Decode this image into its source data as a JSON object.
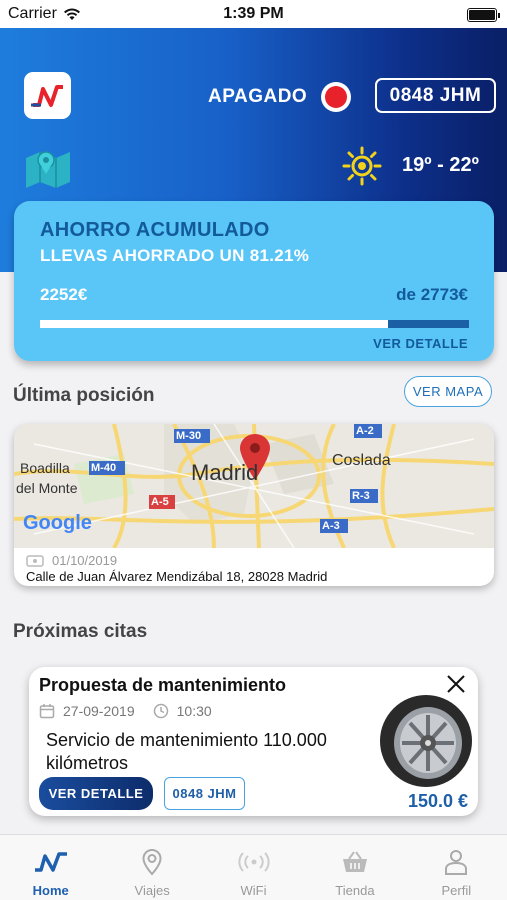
{
  "status_bar": {
    "carrier": "Carrier",
    "time": "1:39 PM"
  },
  "header": {
    "engine_status": "APAGADO",
    "plate": "0848 JHM",
    "temperature": "19º - 22º",
    "colors": {
      "status_dot": "#e8222a",
      "gradient_start": "#1e7ddc",
      "gradient_end": "#0a1f66"
    }
  },
  "savings": {
    "title": "AHORRO ACUMULADO",
    "subtitle": "LLEVAS AHORRADO UN 81.21%",
    "saved": "2252€",
    "total": "de 2773€",
    "progress_fraction": 0.8121,
    "detail_label": "VER DETALLE"
  },
  "last_position": {
    "title": "Última posición",
    "map_button": "VER MAPA",
    "date": "01/10/2019",
    "address": "Calle de Juan Álvarez Mendizábal 18, 28028 Madrid",
    "map_labels": {
      "madrid": "Madrid",
      "coslada": "Coslada",
      "boadilla_1": "Boadilla",
      "boadilla_2": "del Monte",
      "m30": "M-30",
      "m40": "M-40",
      "a5": "A-5",
      "a2": "A-2",
      "r3": "R-3",
      "a3": "A-3",
      "google": "Google"
    }
  },
  "appointments": {
    "title": "Próximas citas",
    "items": [
      {
        "title": "Propuesta de mantenimiento",
        "date": "27-09-2019",
        "time": "10:30",
        "description": "Servicio de mantenimiento 110.000 kilómetros",
        "detail_button": "VER DETALLE",
        "plate": "0848 JHM",
        "price": "150.0 €"
      }
    ]
  },
  "tabs": [
    {
      "label": "Home",
      "icon": "home-logo-icon",
      "active": true
    },
    {
      "label": "Viajes",
      "icon": "location-pin-icon",
      "active": false
    },
    {
      "label": "WiFi",
      "icon": "wifi-broadcast-icon",
      "active": false
    },
    {
      "label": "Tienda",
      "icon": "shopping-basket-icon",
      "active": false
    },
    {
      "label": "Perfil",
      "icon": "user-icon",
      "active": false
    }
  ]
}
